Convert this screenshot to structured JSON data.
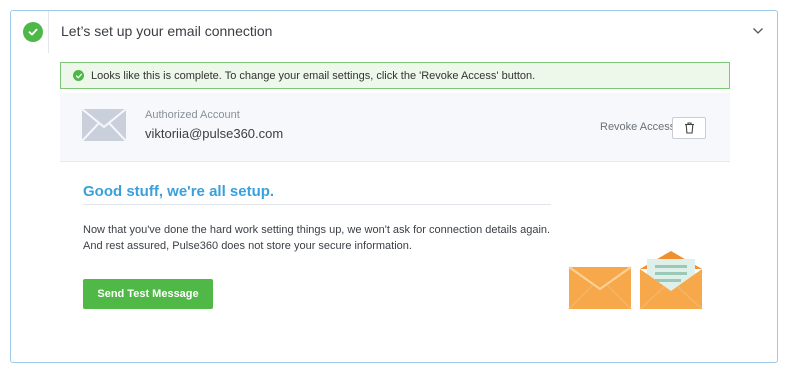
{
  "header": {
    "title": "Let’s set up your email connection",
    "status_icon": "check-circle-icon",
    "toggle_icon": "chevron-down-icon"
  },
  "alert": {
    "text": "Looks like this is complete. To change your email settings, click the 'Revoke Access' button.",
    "icon": "check-icon"
  },
  "account": {
    "label": "Authorized Account",
    "email": "viktoriia@pulse360.com",
    "revoke_label": "Revoke Access",
    "revoke_icon": "trash-icon",
    "envelope_icon": "envelope-icon"
  },
  "content": {
    "title": "Good stuff, we're all setup.",
    "line1": "Now that you've done the hard work setting things up, we won't ask for connection details again.",
    "line2": "And rest assured, Pulse360 does not store your secure information.",
    "button_label": "Send Test Message"
  },
  "colors": {
    "success_green": "#4db848",
    "accent_blue": "#3aa0dd",
    "alert_bg": "#edf7ea",
    "envelope_orange": "#f7a84a"
  }
}
